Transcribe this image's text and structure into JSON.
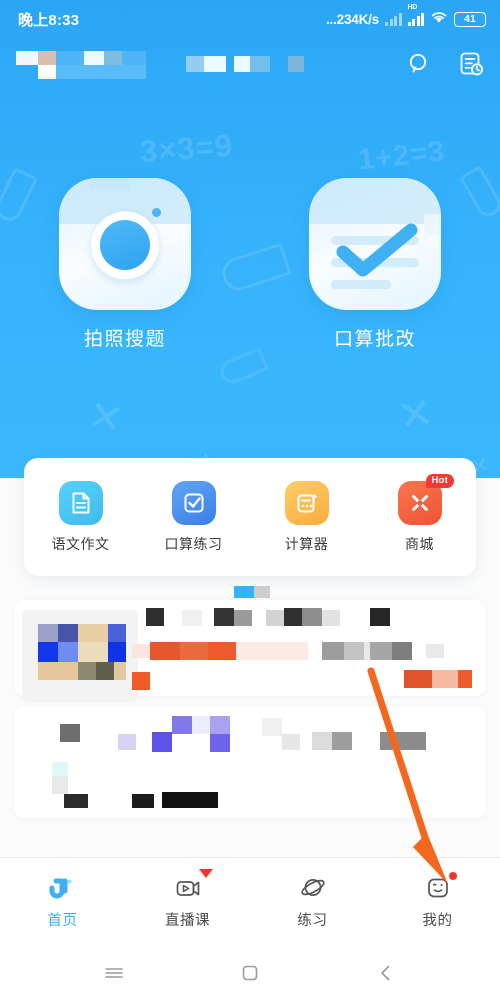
{
  "statusbar": {
    "time": "晚上8:33",
    "network_speed": "...234K/s",
    "hd_label": "HD",
    "battery": "41",
    "signal_icon": "signal-bars-icon",
    "wifi_icon": "wifi-icon"
  },
  "appbar": {
    "search_icon": "search-icon",
    "history_icon": "history-records-icon",
    "masked_title": "",
    "masked_tag_1": "",
    "masked_tag_2": "",
    "masked_tag_3": ""
  },
  "hero": {
    "background_color": "#36b2fb",
    "deco_equation_1": "3×3=9",
    "deco_equation_2": "1+2=3",
    "deco_symbol": "✕",
    "entries": [
      {
        "label": "拍照搜题",
        "icon": "camera-icon"
      },
      {
        "label": "口算批改",
        "icon": "check-paper-icon"
      }
    ]
  },
  "quick_actions": [
    {
      "label": "语文作文",
      "icon": "document-icon",
      "color": "#4fc8f4",
      "badge": ""
    },
    {
      "label": "口算练习",
      "icon": "checkbox-icon",
      "color": "#4a8ef0",
      "badge": ""
    },
    {
      "label": "计算器",
      "icon": "calculator-icon",
      "color": "#fcb94d",
      "badge": ""
    },
    {
      "label": "商城",
      "icon": "shop-icon",
      "color": "#f3613f",
      "badge": "Hot"
    }
  ],
  "feed": {
    "note": "censored",
    "masked_rows": 3
  },
  "annotation": {
    "arrow_color": "#f4671f",
    "points_to": "我的"
  },
  "tabbar": {
    "items": [
      {
        "label": "首页",
        "icon": "home-icon",
        "active": true,
        "badge": "none"
      },
      {
        "label": "直播课",
        "icon": "live-video-icon",
        "active": false,
        "badge": "triangle"
      },
      {
        "label": "练习",
        "icon": "planet-practice-icon",
        "active": false,
        "badge": "none"
      },
      {
        "label": "我的",
        "icon": "smiley-profile-icon",
        "active": false,
        "badge": "dot"
      }
    ],
    "active_color": "#38b0f5"
  },
  "navbar": {
    "recents_icon": "menu-icon",
    "home_icon": "square-home-icon",
    "back_icon": "chevron-left-icon"
  }
}
